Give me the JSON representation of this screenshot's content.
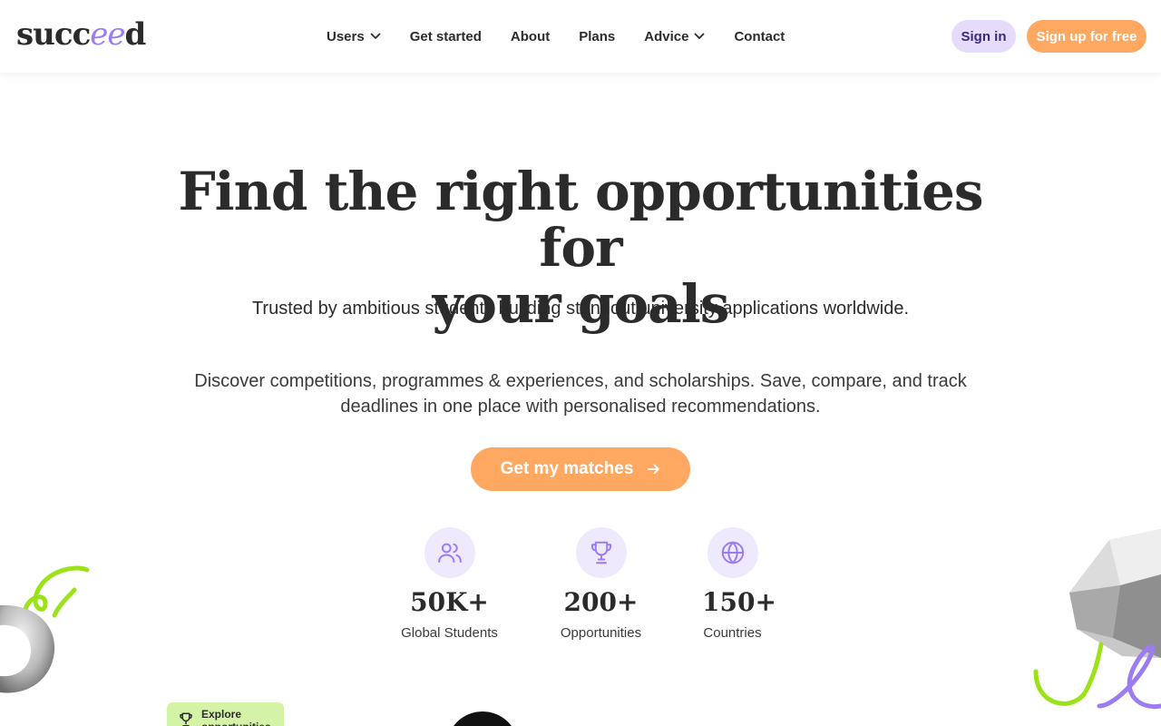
{
  "brand": {
    "logo_start": "succ",
    "logo_mid": "ee",
    "logo_end": "d"
  },
  "nav": {
    "items": [
      {
        "label": "Users",
        "has_dropdown": true
      },
      {
        "label": "Get started",
        "has_dropdown": false
      },
      {
        "label": "About",
        "has_dropdown": false
      },
      {
        "label": "Plans",
        "has_dropdown": false
      },
      {
        "label": "Advice",
        "has_dropdown": true
      },
      {
        "label": "Contact",
        "has_dropdown": false
      }
    ],
    "signin_label": "Sign in",
    "signup_label": "Sign up for free"
  },
  "hero": {
    "title_line1": "Find the right opportunities for",
    "title_line2": "your goals",
    "subtitle": "Trusted by ambitious students building standout university applications worldwide.",
    "description": "Discover competitions, programmes & experiences, and scholarships. Save, compare, and track deadlines in one place with personalised recommendations.",
    "cta_label": "Get my matches"
  },
  "stats": [
    {
      "icon": "users-icon",
      "value": "50K+",
      "label": "Global Students"
    },
    {
      "icon": "trophy-icon",
      "value": "200+",
      "label": "Opportunities"
    },
    {
      "icon": "globe-icon",
      "value": "150+",
      "label": "Countries"
    }
  ],
  "preview": {
    "explore_label": "Explore opportunities"
  },
  "colors": {
    "accent_orange": "#ffa862",
    "accent_purple": "#9b7cf2",
    "purple_light": "#e5dbfb",
    "icon_bg": "#efe9fd",
    "lime": "#9be21a"
  }
}
